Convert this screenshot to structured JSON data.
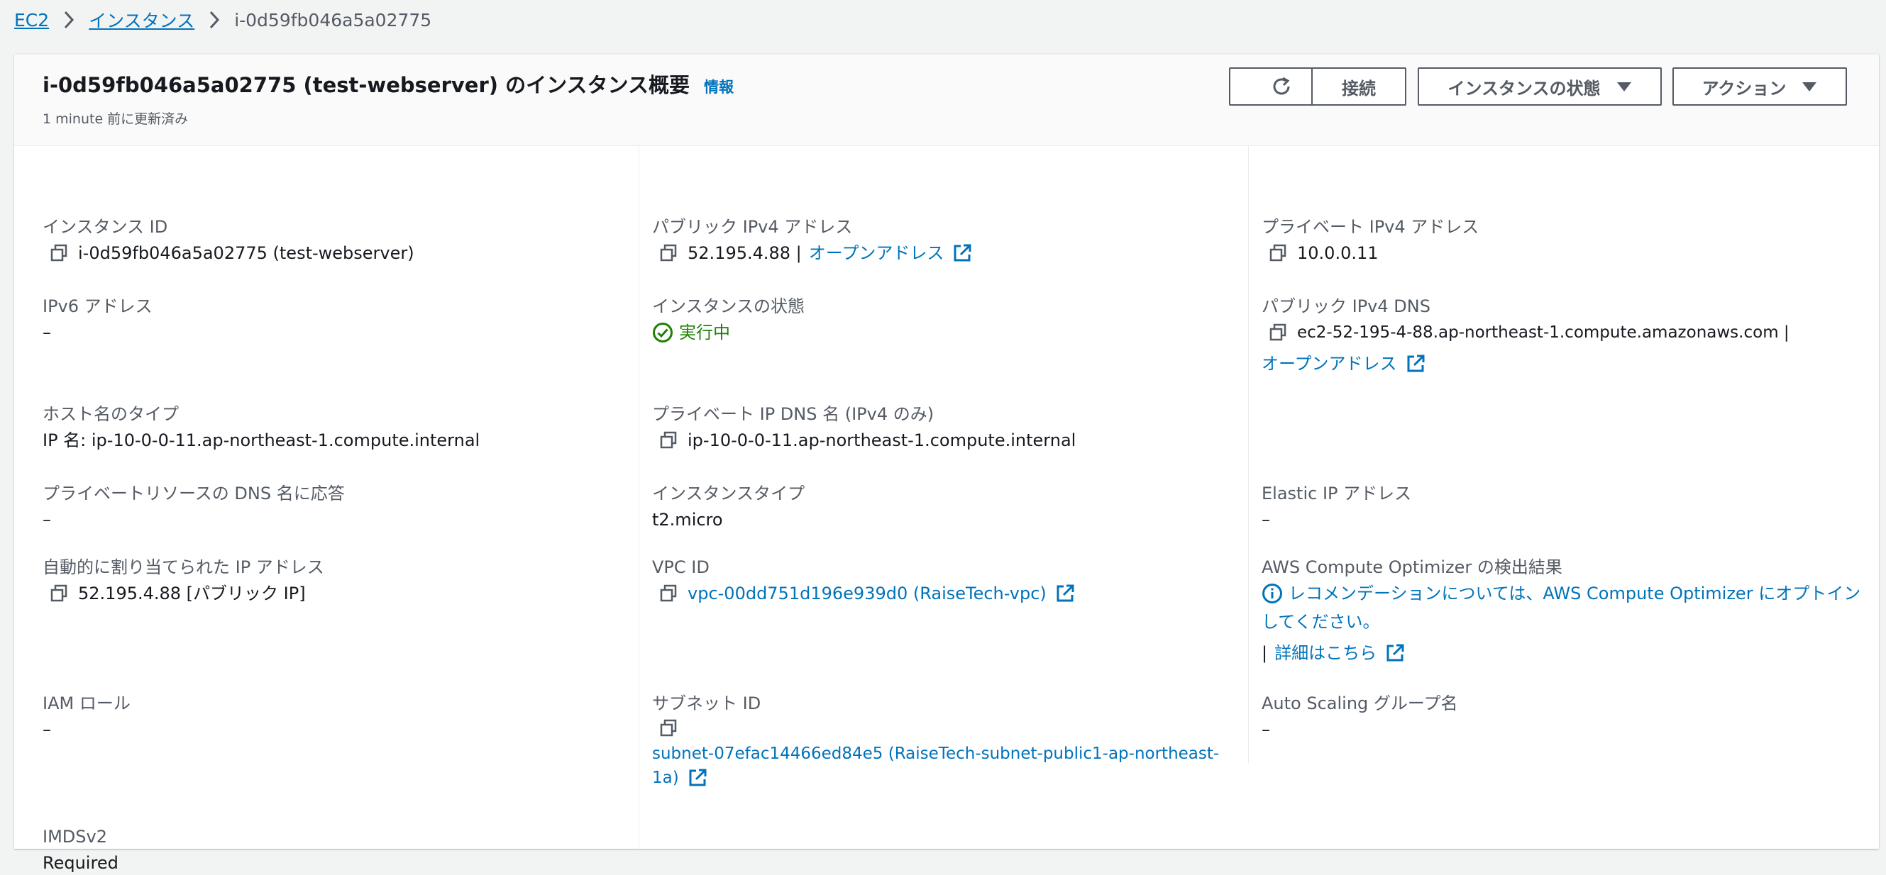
{
  "breadcrumb": {
    "root": "EC2",
    "instances": "インスタンス",
    "current": "i-0d59fb046a5a02775"
  },
  "header": {
    "title": "i-0d59fb046a5a02775 (test-webserver) のインスタンス概要",
    "info": "情報",
    "updated": "1 minute 前に更新済み",
    "refresh_icon": "refresh-icon",
    "connect": "接続",
    "instance_state": "インスタンスの状態",
    "actions": "アクション"
  },
  "fields": {
    "instance_id": {
      "label": "インスタンス ID",
      "value": "i-0d59fb046a5a02775 (test-webserver)"
    },
    "public_ipv4": {
      "label": "パブリック IPv4 アドレス",
      "value": "52.195.4.88 |",
      "link": "オープンアドレス"
    },
    "private_ipv4": {
      "label": "プライベート IPv4 アドレス",
      "value": "10.0.0.11"
    },
    "ipv6": {
      "label": "IPv6 アドレス",
      "value": "–"
    },
    "state": {
      "label": "インスタンスの状態",
      "value": "実行中",
      "color": "#1d8102"
    },
    "public_dns": {
      "label": "パブリック IPv4 DNS",
      "value": "ec2-52-195-4-88.ap-northeast-1.compute.amazonaws.com |",
      "link": "オープンアドレス"
    },
    "hostname_type": {
      "label": "ホスト名のタイプ",
      "value": "IP 名: ip-10-0-0-11.ap-northeast-1.compute.internal"
    },
    "private_dns": {
      "label": "プライベート IP DNS 名 (IPv4 のみ)",
      "value": "ip-10-0-0-11.ap-northeast-1.compute.internal"
    },
    "private_resource_dns": {
      "label": "プライベートリソースの DNS 名に応答",
      "value": "–"
    },
    "instance_type": {
      "label": "インスタンスタイプ",
      "value": "t2.micro"
    },
    "elastic_ip": {
      "label": "Elastic IP アドレス",
      "value": "–"
    },
    "auto_ip": {
      "label": "自動的に割り当てられた IP アドレス",
      "value": "52.195.4.88 [パブリック IP]"
    },
    "vpc_id": {
      "label": "VPC ID",
      "value": "vpc-00dd751d196e939d0 (RaiseTech-vpc)"
    },
    "optimizer": {
      "label": "AWS Compute Optimizer の検出結果",
      "line1": "レコメンデーションについては、AWS Compute Optimizer にオプトイン",
      "line2": "してください。",
      "sep": "|",
      "more": "詳細はこちら"
    },
    "iam_role": {
      "label": "IAM ロール",
      "value": "–"
    },
    "subnet_id": {
      "label": "サブネット ID",
      "line1": "subnet-07efac14466ed84e5 (RaiseTech-subnet-public1-ap-northeast-",
      "line2": "1a)"
    },
    "asg": {
      "label": "Auto Scaling グループ名",
      "value": "–"
    },
    "imdsv2": {
      "label": "IMDSv2",
      "value": "Required"
    }
  },
  "colors": {
    "link": "#0073bb",
    "success": "#1d8102",
    "text": "#16191f",
    "label": "#545b64"
  }
}
